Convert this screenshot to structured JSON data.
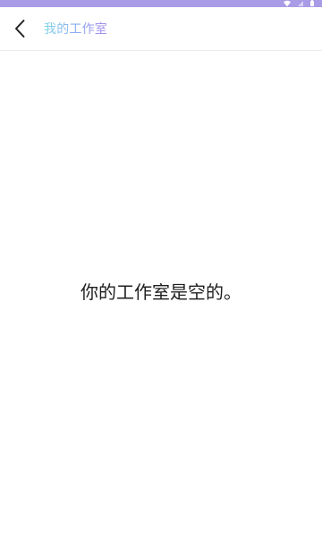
{
  "status_bar": {
    "icons": [
      "wifi-icon",
      "signal-icon",
      "battery-icon"
    ],
    "accent_color": "#a99be6"
  },
  "header": {
    "title": "我的工作室",
    "back_icon": "chevron-left-icon"
  },
  "main": {
    "empty_message": "你的工作室是空的。"
  }
}
